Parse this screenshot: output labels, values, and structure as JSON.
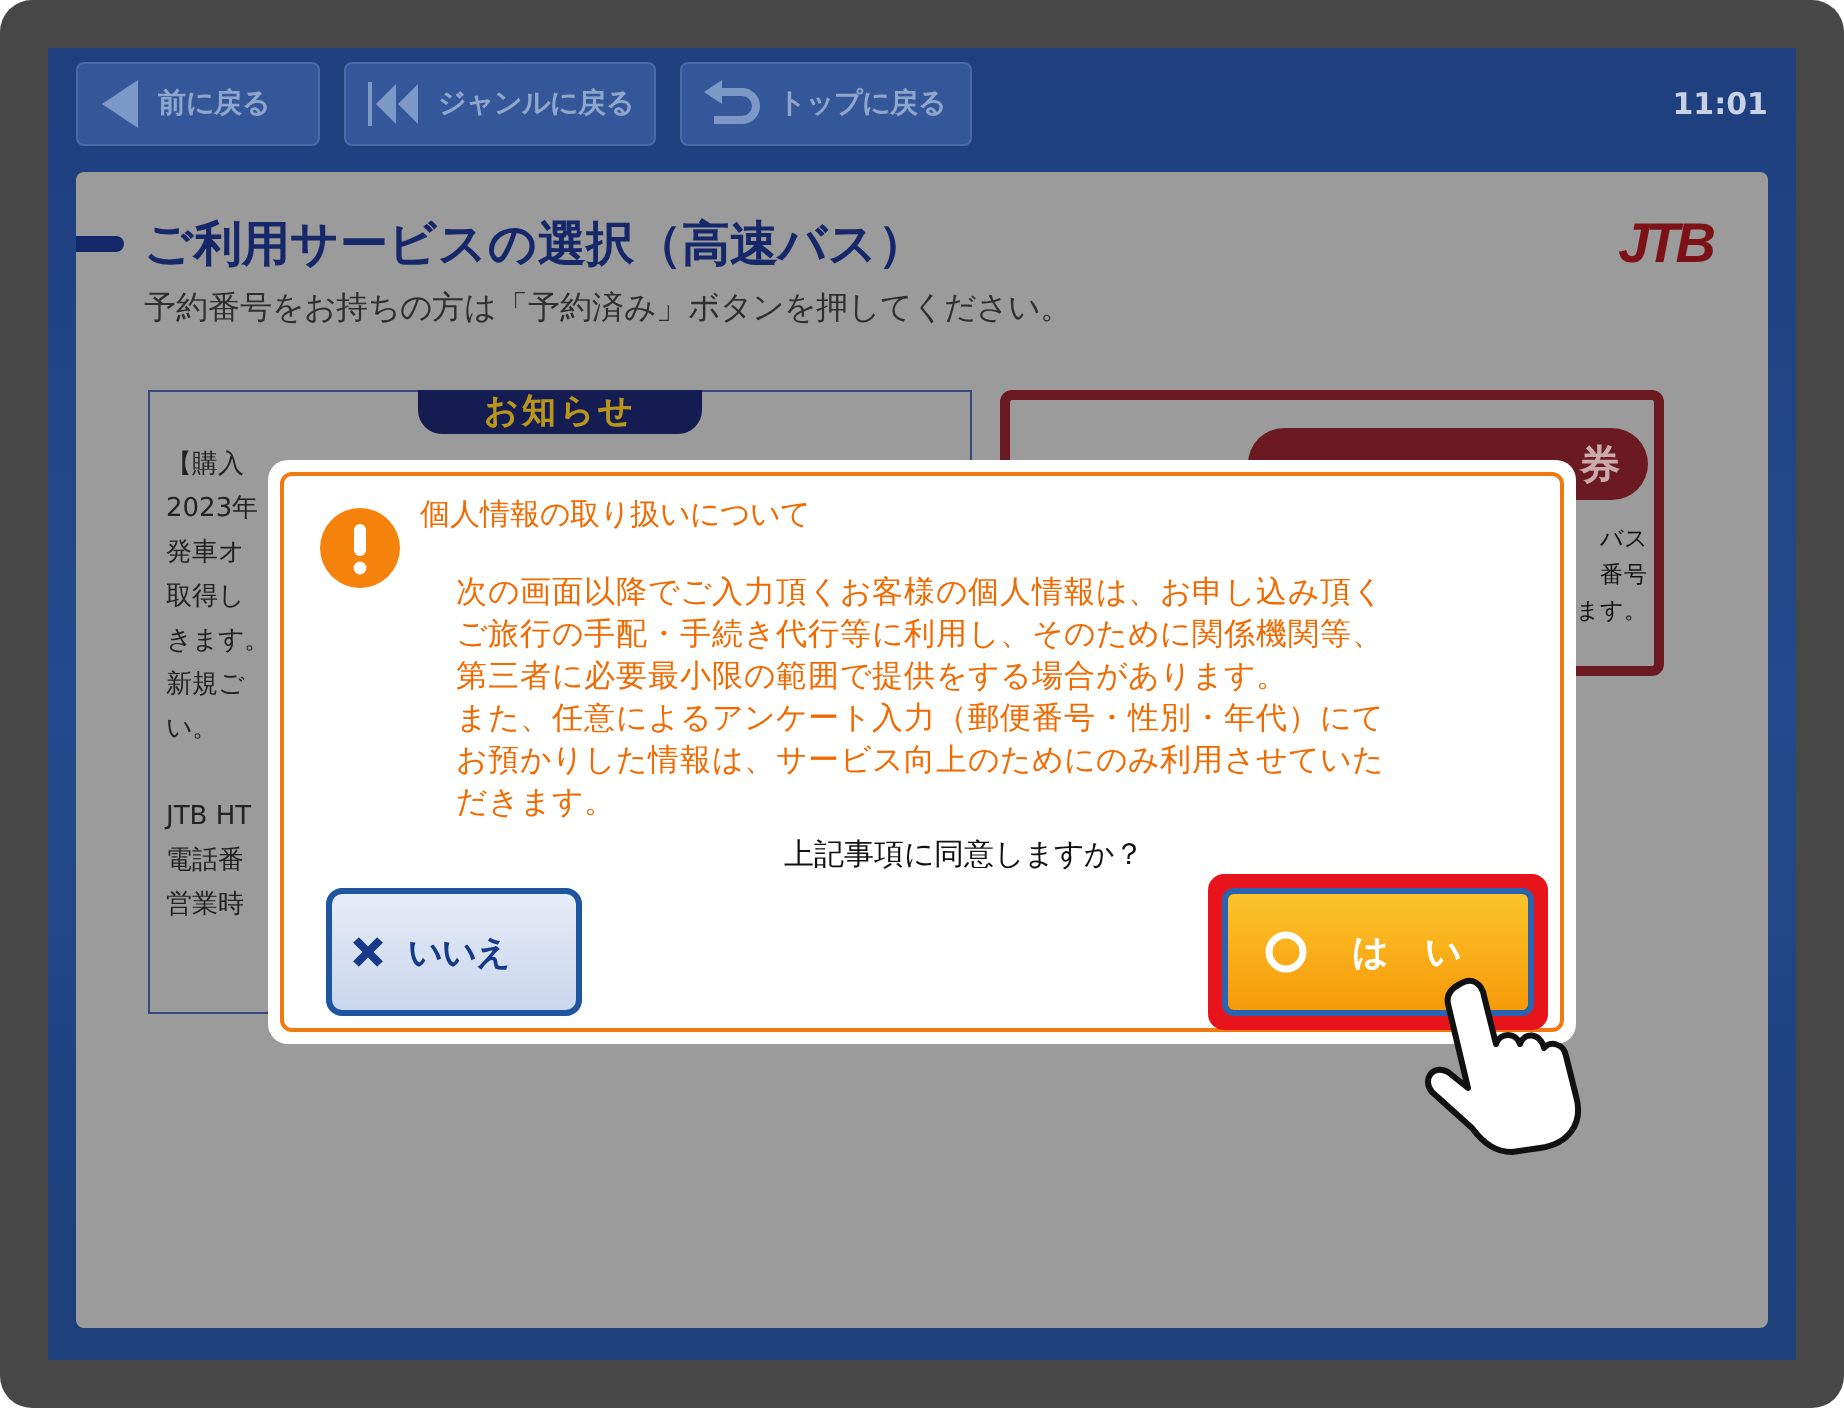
{
  "top_bar": {
    "buttons": [
      {
        "label": "前に戻る",
        "kind": "back"
      },
      {
        "label": "ジャンルに戻る",
        "kind": "rewind"
      },
      {
        "label": "トップに戻る",
        "kind": "return"
      }
    ],
    "clock": "11:01"
  },
  "page": {
    "title": "ご利用サービスの選択（高速バス）",
    "subtitle": "予約番号をお持ちの方は「予約済み」ボタンを押してください。",
    "logo": "JTB",
    "notice": {
      "heading": "お知らせ",
      "paragraphs": [
        [
          "【購入",
          "2023年",
          "発車オ",
          "取得し",
          "きます。",
          "新規ご",
          "い。"
        ],
        [
          "JTB HT",
          "電話番",
          "営業時"
        ]
      ]
    },
    "card": {
      "badge": "券",
      "lines": [
        "バス",
        "番号",
        "ます。"
      ]
    }
  },
  "dialog": {
    "heading": "個人情報の取り扱いについて",
    "body_lines": [
      "次の画面以降でご入力頂くお客様の個人情報は、お申し込み頂く",
      "ご旅行の手配・手続き代行等に利用し、そのために関係機関等、",
      "第三者に必要最小限の範囲で提供をする場合があります。",
      "また、任意によるアンケート入力（郵便番号・性別・年代）にて",
      "お預かりした情報は、サービス向上のためにのみ利用させていた",
      "だきます。"
    ],
    "question": "上記事項に同意しますか？",
    "buttons": [
      {
        "label": "いいえ",
        "kind": "no",
        "highlighted": false
      },
      {
        "label": "は い",
        "kind": "yes",
        "highlighted": true
      }
    ]
  }
}
